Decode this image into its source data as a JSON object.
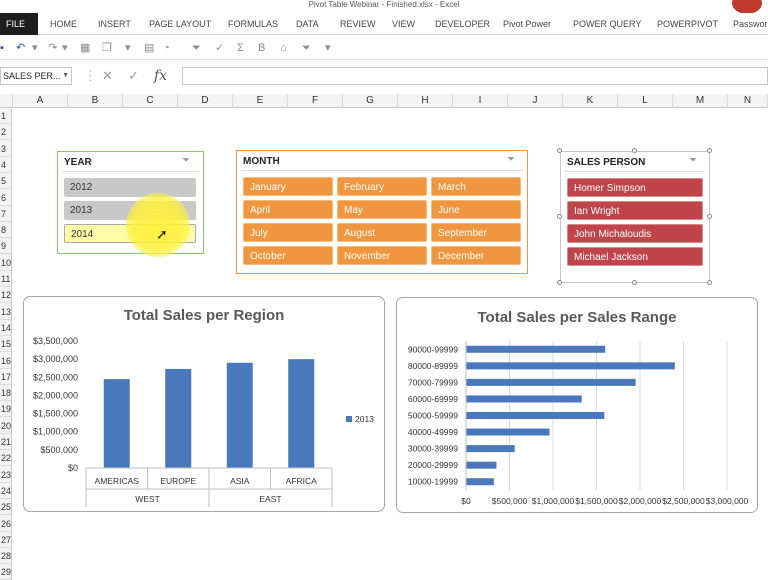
{
  "window": {
    "title": "Pivot Table Webinar - Finished.xlsx - Excel"
  },
  "ribbon_tabs": [
    "FILE",
    "HOME",
    "INSERT",
    "PAGE LAYOUT",
    "FORMULAS",
    "DATA",
    "REVIEW",
    "VIEW",
    "DEVELOPER",
    "Pivot Power",
    "POWER QUERY",
    "POWERPIVOT",
    "Passwor"
  ],
  "formula_bar": {
    "name_box": "SALES PER...",
    "value": ""
  },
  "columns": [
    "A",
    "B",
    "C",
    "D",
    "E",
    "F",
    "G",
    "H",
    "I",
    "J",
    "K",
    "L",
    "M",
    "N"
  ],
  "rows": [
    "1",
    "2",
    "3",
    "4",
    "5",
    "6",
    "7",
    "8",
    "9",
    "10",
    "11",
    "12",
    "13",
    "14",
    "15",
    "16",
    "17",
    "18",
    "19",
    "20",
    "21",
    "22",
    "23",
    "24",
    "25",
    "26",
    "27",
    "28",
    "29"
  ],
  "slicers": {
    "year": {
      "header": "YEAR",
      "items": [
        "2012",
        "2013",
        "2014"
      ],
      "selected": "2014"
    },
    "month": {
      "header": "MONTH",
      "items": [
        "January",
        "February",
        "March",
        "April",
        "May",
        "June",
        "July",
        "August",
        "September",
        "October",
        "November",
        "December"
      ]
    },
    "sales_person": {
      "header": "SALES PERSON",
      "items": [
        "Homer Simpson",
        "Ian Wright",
        "John Michaloudis",
        "Michael Jackson"
      ]
    }
  },
  "colors": {
    "orange": "#f0963e",
    "red": "#bf454b",
    "bar": "#4a78bc",
    "selected": "#fffba6"
  },
  "chart_data": [
    {
      "type": "bar",
      "title": "Total Sales per Region",
      "categories": [
        "AMERICAS",
        "EUROPE",
        "ASIA",
        "AFRICA"
      ],
      "groups": [
        {
          "label": "WEST",
          "span": 2
        },
        {
          "label": "EAST",
          "span": 2
        }
      ],
      "series": [
        {
          "name": "2013",
          "values": [
            2450000,
            2730000,
            2900000,
            3000000
          ]
        }
      ],
      "y_ticks": [
        "$3,500,000",
        "$3,000,000",
        "$2,500,000",
        "$2,000,000",
        "$1,500,000",
        "$1,000,000",
        "$500,000",
        "$0"
      ],
      "ylim": [
        0,
        3500000
      ],
      "legend": "right"
    },
    {
      "type": "bar",
      "orientation": "horizontal",
      "title": "Total Sales per Sales Range",
      "categories": [
        "90000-99999",
        "80000-89999",
        "70000-79999",
        "60000-69999",
        "50000-59999",
        "40000-49999",
        "30000-39999",
        "20000-29999",
        "10000-19999"
      ],
      "values": [
        1600000,
        2400000,
        1950000,
        1330000,
        1590000,
        960000,
        560000,
        350000,
        320000
      ],
      "x_ticks": [
        "$0",
        "$500,000",
        "$1,000,000",
        "$1,500,000",
        "$2,000,000",
        "$2,500,000",
        "$3,000,000"
      ],
      "xlim": [
        0,
        3000000
      ],
      "grid": true
    }
  ]
}
